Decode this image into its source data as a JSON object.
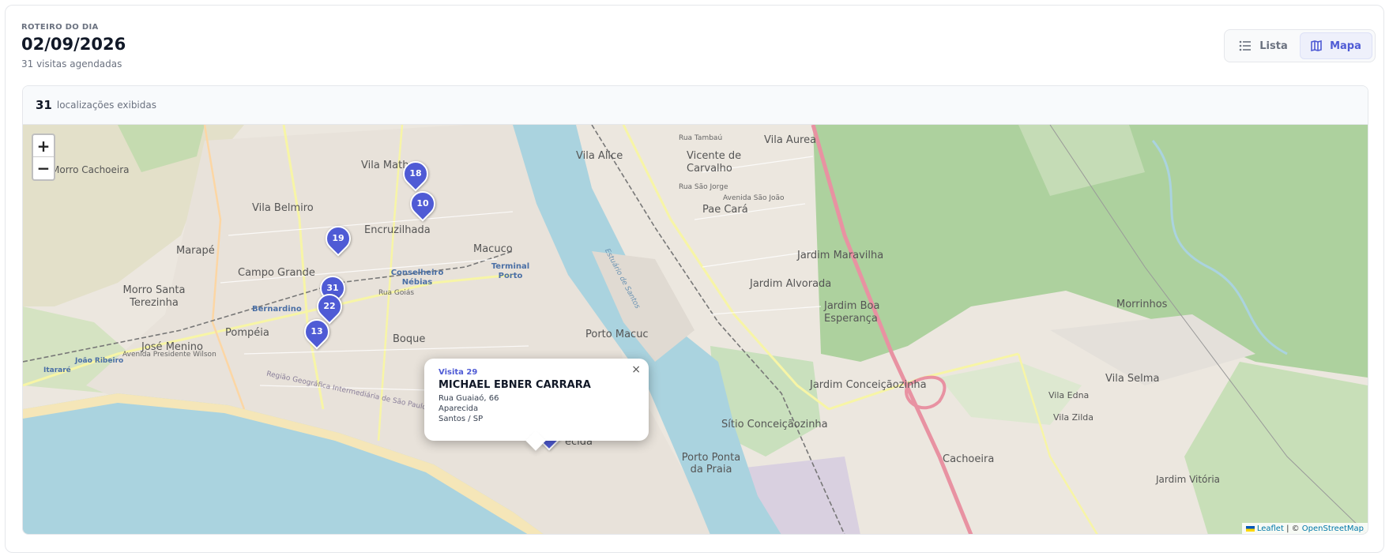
{
  "header": {
    "eyebrow": "ROTEIRO DO DIA",
    "date": "02/09/2026",
    "subtitle": "31 visitas agendadas"
  },
  "view_toggle": {
    "lista_label": "Lista",
    "mapa_label": "Mapa",
    "selected": "Mapa"
  },
  "summary": {
    "count": "31",
    "label": "localizações exibidas"
  },
  "map": {
    "zoom_in": "+",
    "zoom_out": "−",
    "markers": [
      "18",
      "10",
      "19",
      "31",
      "22",
      "13",
      "29"
    ],
    "labels": {
      "vila_aurea": "Vila Aurea",
      "vila_alice": "Vila Alice",
      "vicente_de_carvalho": "Vicente de\nCarvalho",
      "pae_cara": "Pae Cará",
      "jardim_maravilha": "Jardim Maravilha",
      "jardim_alvorada": "Jardim Alvorada",
      "jardim_boa_esperanca": "Jardim Boa\nEsperança",
      "morrinhos": "Morrinhos",
      "vila_selma": "Vila Selma",
      "vila_edna": "Vila Edna",
      "vila_zilda": "Vila Zilda",
      "jardim_conceicaozinha": "Jardim Conceiçãozinha",
      "sitio_conceicaozinha": "Sítio Conceiçãozinha",
      "cachoeira": "Cachoeira",
      "jardim_vitoria": "Jardim Vitória",
      "porto_ponta_da_praia": "Porto Ponta\nda Praia",
      "vila_mathias": "Vila Math",
      "vila_belmiro": "Vila Belmiro",
      "encruzilhada": "Encruzilhada",
      "macuco": "Macuco",
      "marape": "Marapé",
      "campo_grande": "Campo Grande",
      "morro_santa_terezinha": "Morro Santa\nTerezinha",
      "jose_menino": "José Menino",
      "pompeia": "Pompéia",
      "bernardino": "Bernardino",
      "conselheiro_nebias": "Conselheiro\nNébias",
      "terminal_porto": "Terminal\nPorto",
      "joao_ribeiro": "João Ribeiro",
      "itarare": "Itararé",
      "morro_cachoeira": "Morro Cachoeira",
      "boqueirao": "Boque",
      "aparecida": "ecida",
      "porto_macuco": "Porto Macuc",
      "rua_goias": "Rua Goiás",
      "avenida_presidente_wilson": "Avenida Presidente Wilson",
      "regiao_geografica": "Região Geográfica Intermediária de São Paulo",
      "estuario": "Estuário de Santos",
      "rua_tambau": "Rua Tambaú",
      "rua_sao_jorge": "Rua São Jorge",
      "avenida_sao_joao": "Avenida São João"
    }
  },
  "popup": {
    "title": "Visita 29",
    "name": "MICHAEL EBNER CARRARA",
    "street": "Rua Guaiaó, 66",
    "district": "Aparecida",
    "city": "Santos / SP",
    "close": "×"
  },
  "attribution": {
    "leaflet": "Leaflet",
    "separator": " | © ",
    "osm": "OpenStreetMap"
  },
  "colors": {
    "accent": "#4f5bd5",
    "water": "#aad3df",
    "forest": "#add19e",
    "land": "#ece7df"
  }
}
